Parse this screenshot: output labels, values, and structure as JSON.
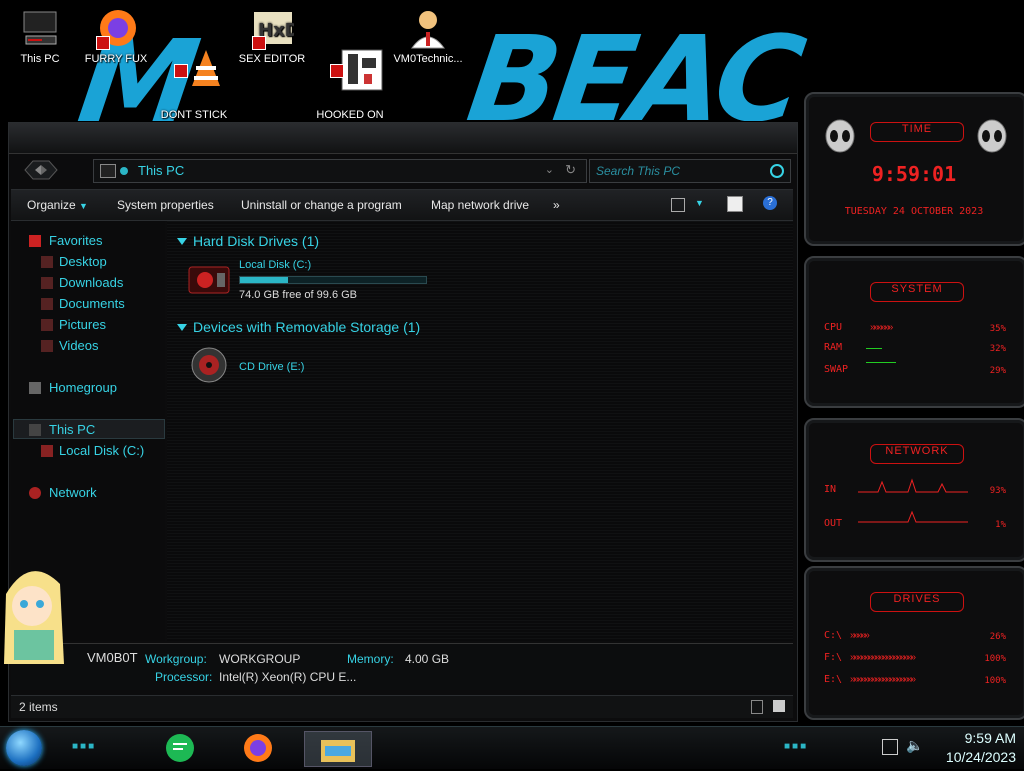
{
  "desktop": {
    "icons": [
      {
        "label": "This PC"
      },
      {
        "label": "FURRY FUX"
      },
      {
        "label": "DONT STICK\nTHIS IN YO..."
      },
      {
        "label": "SEX EDITOR"
      },
      {
        "label": "HOOKED ON\nXONIX"
      },
      {
        "label": "VM0Technic..."
      }
    ]
  },
  "explorer": {
    "address": "This PC",
    "search_placeholder": "Search This PC",
    "toolbar": {
      "organize": "Organize",
      "system_properties": "System properties",
      "uninstall": "Uninstall or change a program",
      "map_drive": "Map network drive",
      "more": "»"
    },
    "nav": {
      "favorites": "Favorites",
      "desktop": "Desktop",
      "downloads": "Downloads",
      "documents": "Documents",
      "pictures": "Pictures",
      "videos": "Videos",
      "homegroup": "Homegroup",
      "this_pc": "This PC",
      "local_disk": "Local Disk (C:)",
      "network": "Network"
    },
    "groups": {
      "hdd": "Hard Disk Drives (1)",
      "removable": "Devices with Removable Storage (1)"
    },
    "drives": {
      "c_name": "Local Disk (C:)",
      "c_free": "74.0 GB free of 99.6 GB",
      "c_used_fraction": 0.257,
      "e_name": "CD Drive (E:)"
    },
    "details": {
      "computer": "VM0B0T",
      "workgroup_label": "Workgroup:",
      "workgroup": "WORKGROUP",
      "memory_label": "Memory:",
      "memory": "4.00 GB",
      "processor_label": "Processor:",
      "processor": "Intel(R) Xeon(R) CPU E..."
    },
    "status": "2 items"
  },
  "gadgets": {
    "time": {
      "header": "TIME",
      "clock": "9:59:01",
      "date": "TUESDAY 24 OCTOBER 2023"
    },
    "system": {
      "header": "SYSTEM",
      "cpu_label": "CPU",
      "cpu": "35%",
      "ram_label": "RAM",
      "ram": "32%",
      "swap_label": "SWAP",
      "swap": "29%"
    },
    "network": {
      "header": "NETWORK",
      "in_label": "IN",
      "in": "93%",
      "out_label": "OUT",
      "out": "1%"
    },
    "drives": {
      "header": "DRIVES",
      "c_label": "C:\\",
      "c": "26%",
      "f_label": "F:\\",
      "f": "100%",
      "e_label": "E:\\",
      "e": "100%"
    }
  },
  "taskbar": {
    "time": "9:59 AM",
    "date": "10/24/2023"
  },
  "colors": {
    "accent": "#37d3e5",
    "gadget_red": "#e22"
  }
}
